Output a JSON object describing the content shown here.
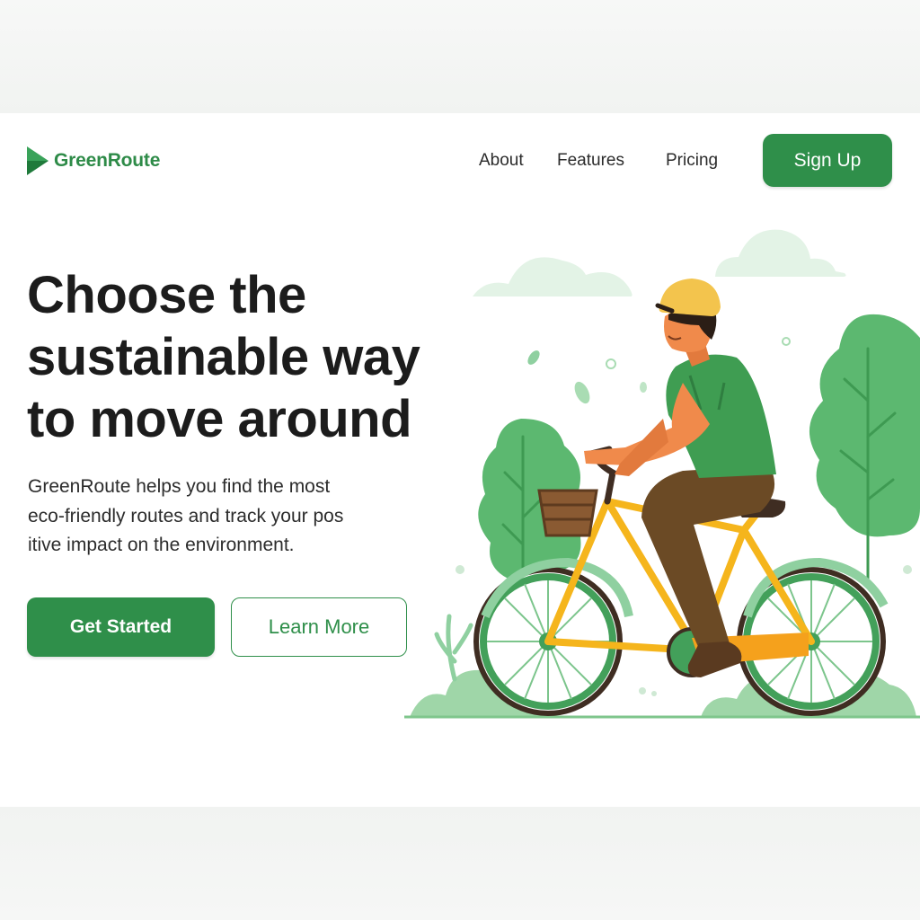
{
  "brand": {
    "name": "GreenRoute",
    "accent": "#2f8f4a"
  },
  "nav": {
    "links": [
      {
        "label": "About"
      },
      {
        "label": "Features"
      },
      {
        "label": "Pricing"
      }
    ],
    "signup_label": "Sign Up"
  },
  "hero": {
    "title_lines": [
      "Choose the",
      "sustainable way",
      "to move around"
    ],
    "description_lines": [
      "GreenRoute helps you find the most",
      "eco-friendly routes and track your pos",
      "itive impact on the environment."
    ],
    "primary_cta": "Get Started",
    "secondary_cta": "Learn More"
  },
  "illustration": {
    "subject": "cyclist-riding-bicycle",
    "colors": {
      "foliage": "#5cb870",
      "light_foliage": "#9fd6a8",
      "bike_frame": "#f5b51c",
      "shirt": "#3f9d52",
      "helmet": "#f3c44d"
    }
  }
}
